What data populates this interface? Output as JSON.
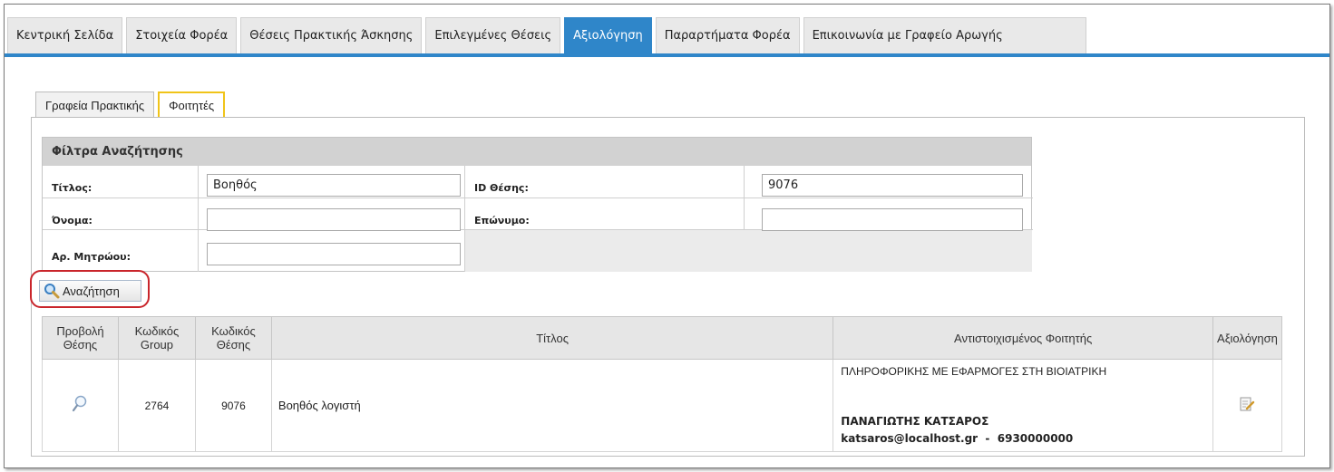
{
  "nav": {
    "tabs": [
      {
        "label": "Κεντρική Σελίδα"
      },
      {
        "label": "Στοιχεία Φορέα"
      },
      {
        "label": "Θέσεις Πρακτικής Άσκησης"
      },
      {
        "label": "Επιλεγμένες Θέσεις"
      },
      {
        "label": "Αξιολόγηση"
      },
      {
        "label": "Παραρτήματα Φορέα"
      },
      {
        "label": "Επικοινωνία με Γραφείο Αρωγής"
      }
    ],
    "active_index": 4,
    "accent_color": "#2f86c9"
  },
  "subtabs": [
    {
      "label": "Γραφεία Πρακτικής"
    },
    {
      "label": "Φοιτητές"
    }
  ],
  "filter": {
    "header": "Φίλτρα Αναζήτησης",
    "title_label": "Τίτλος:",
    "title_value": "Βοηθός",
    "position_id_label": "ID Θέσης:",
    "position_id_value": "9076",
    "first_name_label": "Όνομα:",
    "first_name_value": "",
    "last_name_label": "Επώνυμο:",
    "last_name_value": "",
    "registry_label": "Αρ. Μητρώου:",
    "registry_value": ""
  },
  "search_button": {
    "label": "Αναζήτηση",
    "icon": "magnifier-icon"
  },
  "table": {
    "columns": [
      "Προβολή Θέσης",
      "Κωδικός Group",
      "Κωδικός Θέσης",
      "Τίτλος",
      "Αντιστοιχισμένος Φοιτητής",
      "Αξιολόγηση"
    ],
    "rows": [
      {
        "view_icon": "view-magnifier-icon",
        "group_code": "2764",
        "position_code": "9076",
        "title": "Βοηθός λογιστή",
        "student_department": "ΠΛΗΡΟΦΟΡΙΚΗΣ ΜΕ ΕΦΑΡΜΟΓΕΣ ΣΤΗ ΒΙΟΙΑΤΡΙΚΗ",
        "student_name": "ΠΑΝΑΓΙΩΤΗΣ ΚΑΤΣΑΡΟΣ",
        "student_contact": "katsaros@localhost.gr  -  6930000000",
        "evaluate_icon": "evaluate-form-icon"
      }
    ]
  }
}
